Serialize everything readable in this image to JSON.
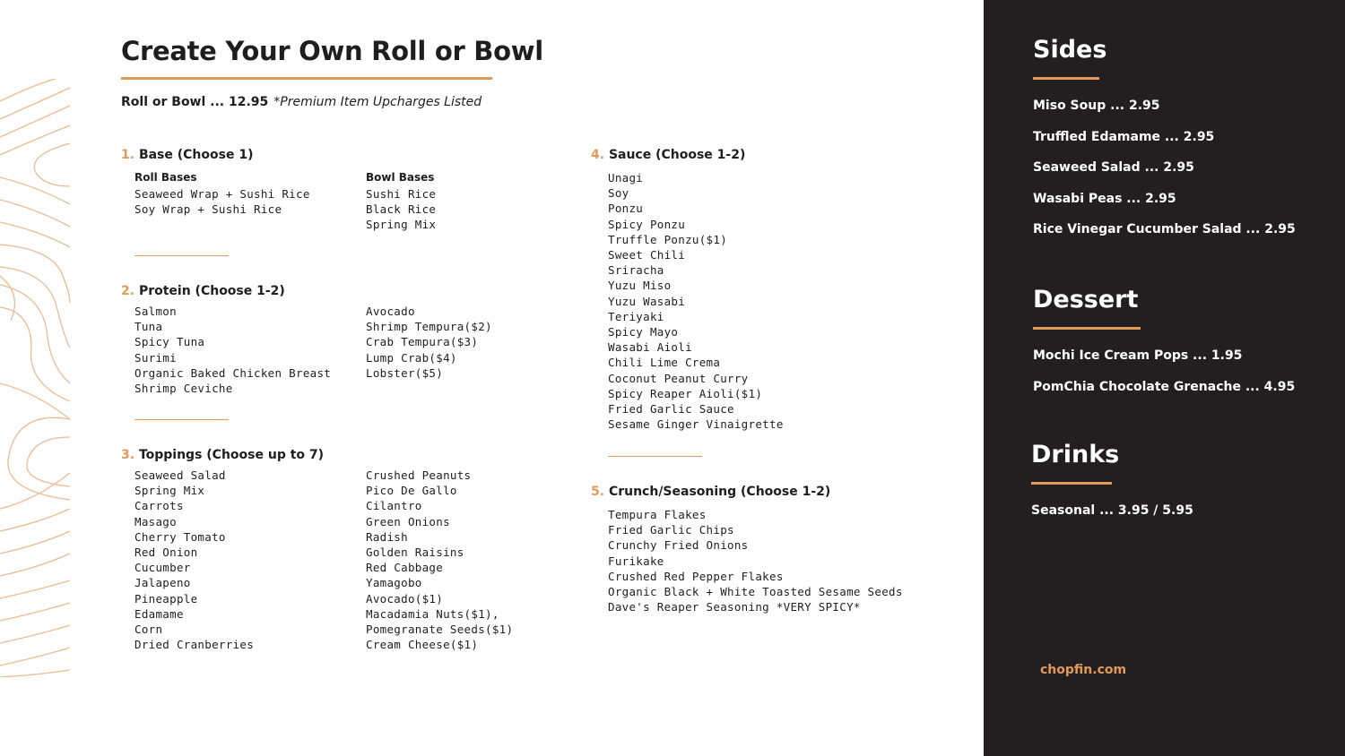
{
  "title": "Create Your Own Roll or Bowl",
  "subtitle": {
    "price": "Roll or Bowl ... 12.95",
    "note": "*Premium Item Upcharges Listed"
  },
  "accent_color": "#e29a5a",
  "panel_color": "#231f20",
  "sections": [
    {
      "num": "1.",
      "label": "Base (Choose 1)",
      "col1_head": "Roll Bases",
      "col2_head": "Bowl Bases",
      "col1": [
        "Seaweed Wrap + Sushi Rice",
        "Soy Wrap + Sushi Rice"
      ],
      "col2": [
        "Sushi Rice",
        "Black Rice",
        "Spring Mix"
      ]
    },
    {
      "num": "2.",
      "label": "Protein (Choose 1-2)",
      "col1": [
        "Salmon",
        "Tuna",
        "Spicy Tuna",
        "Surimi",
        "Organic Baked Chicken Breast",
        "Shrimp Ceviche"
      ],
      "col2": [
        "Avocado",
        "Shrimp Tempura($2)",
        "Crab Tempura($3)",
        "Lump Crab($4)",
        "Lobster($5)"
      ]
    },
    {
      "num": "3.",
      "label": "Toppings (Choose up to 7)",
      "col1": [
        "Seaweed Salad",
        "Spring Mix",
        "Carrots",
        "Masago",
        "Cherry Tomato",
        "Red Onion",
        "Cucumber",
        "Jalapeno",
        "Pineapple",
        "Edamame",
        "Corn",
        "Dried Cranberries"
      ],
      "col2": [
        "Crushed Peanuts",
        "Pico De Gallo",
        "Cilantro",
        "Green Onions",
        "Radish",
        "Golden Raisins",
        "Red Cabbage",
        "Yamagobo",
        "Avocado($1)",
        "Macadamia Nuts($1),",
        "Pomegranate Seeds($1)",
        "Cream Cheese($1)"
      ]
    },
    {
      "num": "4.",
      "label": "Sauce (Choose 1-2)",
      "col1": [
        "Unagi",
        "Soy",
        "Ponzu",
        "Spicy Ponzu",
        "Truffle Ponzu($1)",
        "Sweet Chili",
        "Sriracha",
        "Yuzu Miso",
        "Yuzu Wasabi",
        "Teriyaki",
        "Spicy Mayo",
        "Wasabi Aioli",
        "Chili Lime Crema",
        "Coconut Peanut Curry",
        "Spicy Reaper Aioli($1)",
        "Fried Garlic Sauce",
        "Sesame Ginger Vinaigrette"
      ]
    },
    {
      "num": "5.",
      "label": "Crunch/Seasoning (Choose 1-2)",
      "col1": [
        "Tempura Flakes",
        "Fried Garlic Chips",
        "Crunchy Fried Onions",
        "Furikake",
        "Crushed Red Pepper Flakes",
        "Organic Black + White Toasted Sesame Seeds",
        "Dave's Reaper Seasoning *VERY SPICY*"
      ]
    }
  ],
  "panel": {
    "sides": {
      "heading": "Sides",
      "items": [
        "Miso Soup ... 2.95",
        "Truffled Edamame ... 2.95",
        "Seaweed Salad ... 2.95",
        "Wasabi Peas ... 2.95",
        "Rice Vinegar Cucumber Salad ... 2.95"
      ]
    },
    "dessert": {
      "heading": "Dessert",
      "items": [
        "Mochi Ice Cream Pops ... 1.95",
        "PomChia Chocolate Grenache ... 4.95"
      ]
    },
    "drinks": {
      "heading": "Drinks",
      "items": [
        "Seasonal ... 3.95 / 5.95"
      ]
    },
    "website": "chopfin.com"
  }
}
